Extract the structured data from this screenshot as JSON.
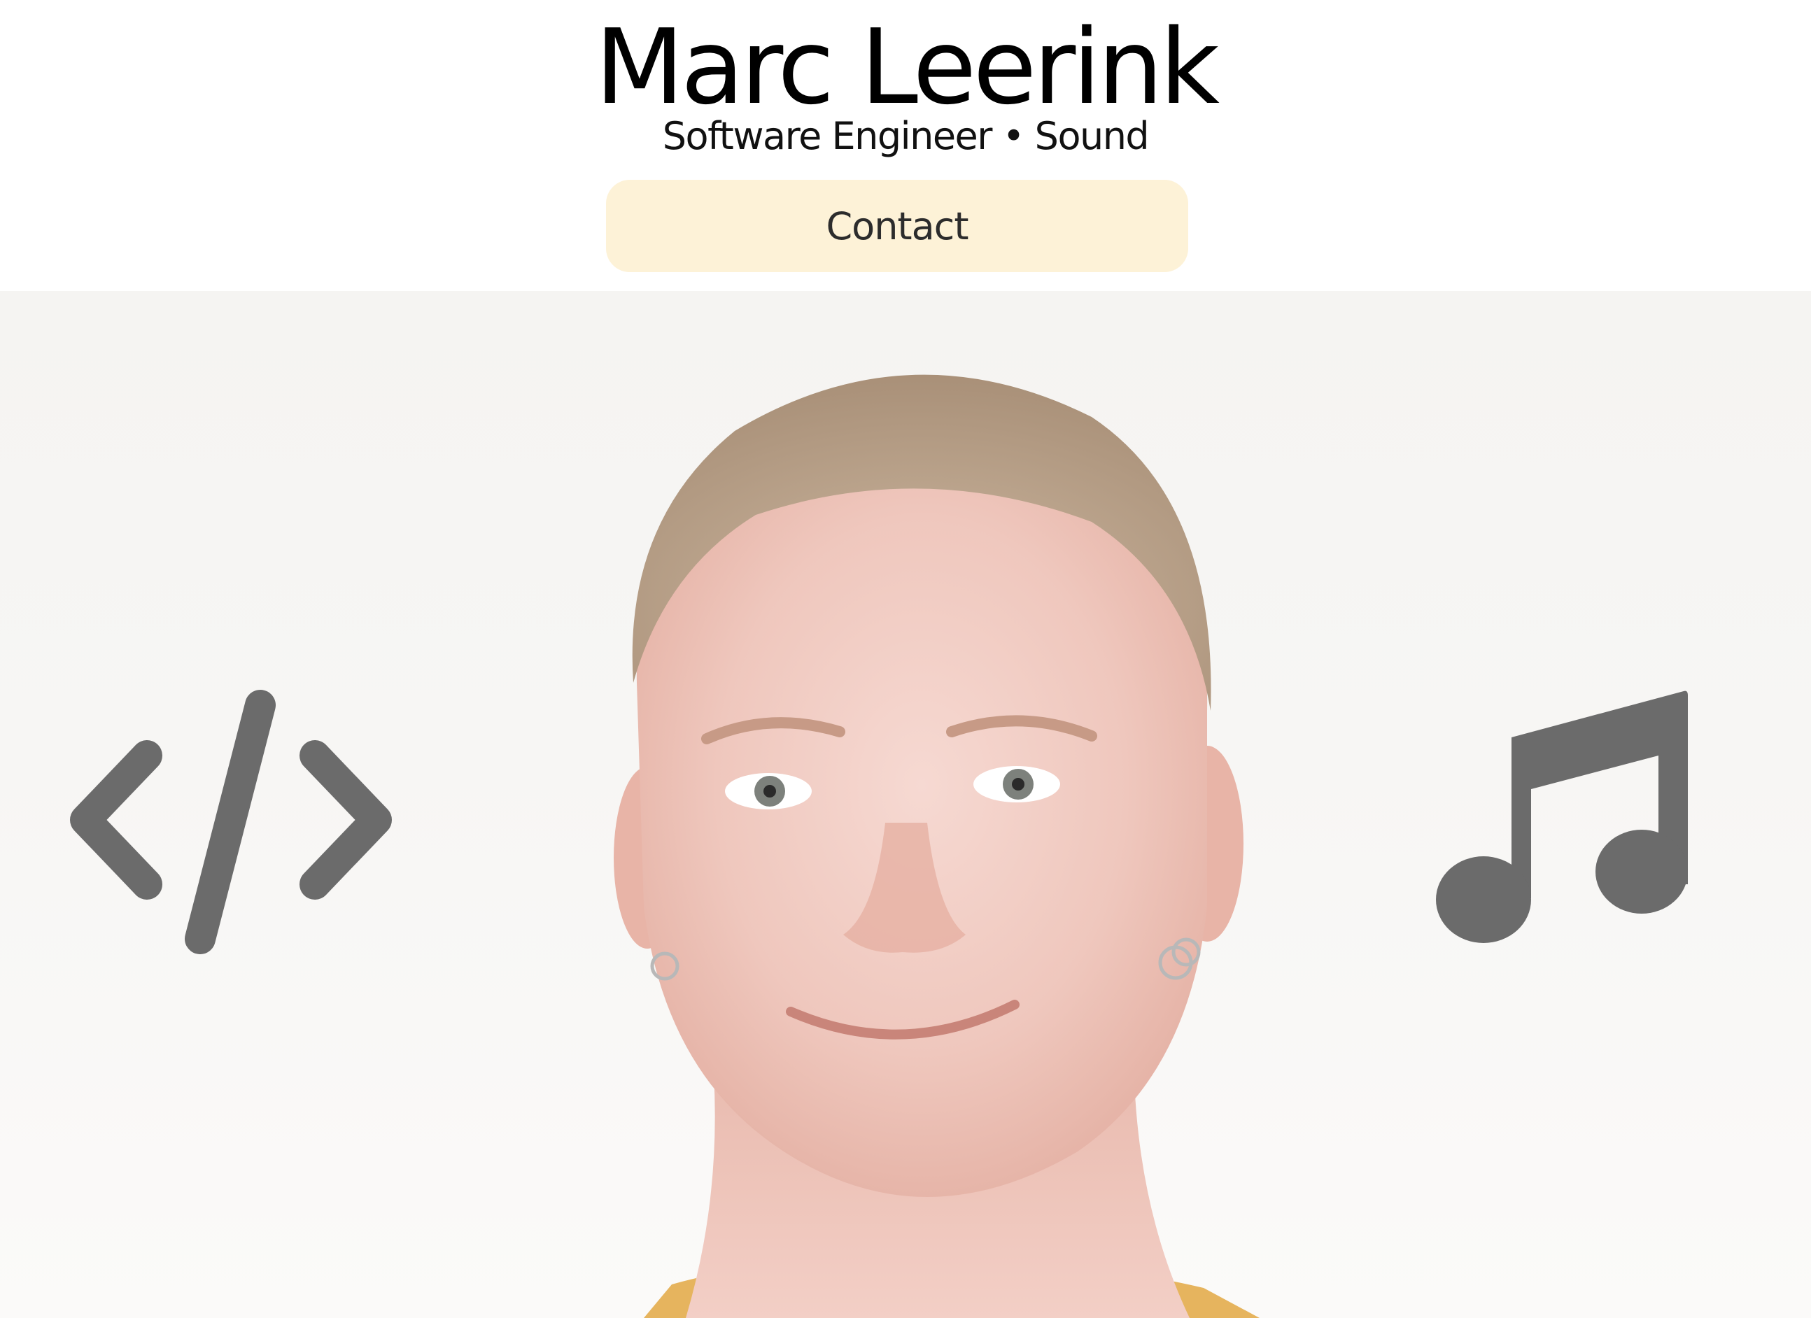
{
  "header": {
    "name": "Marc Leerink",
    "tagline": "Software Engineer • Sound",
    "contact_label": "Contact"
  },
  "hero": {
    "photo": "portrait-photo",
    "left_icon": "code-icon",
    "right_icon": "music-note-icon",
    "icon_color": "#6b6b6b"
  },
  "colors": {
    "contact_button_bg": "#fdf2d7",
    "background": "#ffffff",
    "text": "#000000"
  }
}
